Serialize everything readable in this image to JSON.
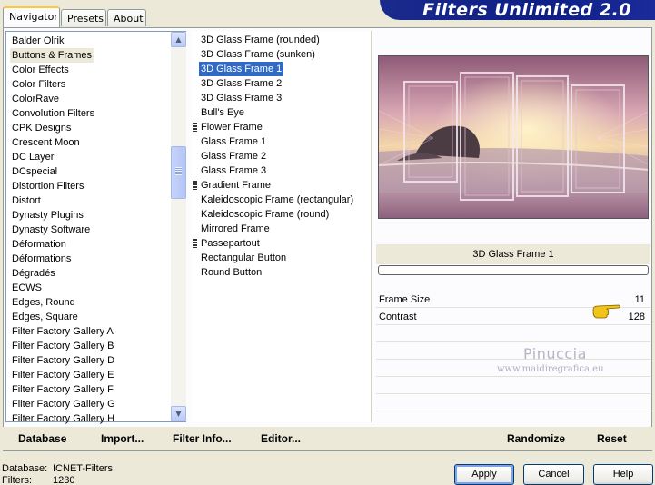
{
  "tabs": [
    "Navigator",
    "Presets",
    "About"
  ],
  "banner_title": "Filters Unlimited 2.0",
  "categories": [
    "Balder Olrik",
    "Buttons & Frames",
    "Color Effects",
    "Color Filters",
    "ColorRave",
    "Convolution Filters",
    "CPK Designs",
    "Crescent Moon",
    "DC Layer",
    "DCspecial",
    "Distortion Filters",
    "Distort",
    "Dynasty Plugins",
    "Dynasty Software",
    "Déformation",
    "Déformations",
    "Dégradés",
    "ECWS",
    "Edges, Round",
    "Edges, Square",
    "Filter Factory Gallery A",
    "Filter Factory Gallery B",
    "Filter Factory Gallery D",
    "Filter Factory Gallery E",
    "Filter Factory Gallery F",
    "Filter Factory Gallery G",
    "Filter Factory Gallery H"
  ],
  "selected_category": "Buttons & Frames",
  "filters": [
    "3D Glass Frame (rounded)",
    "3D Glass Frame (sunken)",
    "3D Glass Frame 1",
    "3D Glass Frame 2",
    "3D Glass Frame 3",
    "Bull's Eye",
    "Flower Frame",
    "Glass Frame 1",
    "Glass Frame 2",
    "Glass Frame 3",
    "Gradient Frame",
    "Kaleidoscopic Frame (rectangular)",
    "Kaleidoscopic Frame (round)",
    "Mirrored Frame",
    "Passepartout",
    "Rectangular Button",
    "Round Button"
  ],
  "selected_filter": "3D Glass Frame 1",
  "marked_filters": [
    "Flower Frame",
    "Gradient Frame",
    "Passepartout"
  ],
  "filter_name_display": "3D Glass Frame 1",
  "params": [
    {
      "label": "Frame Size",
      "value": "11"
    },
    {
      "label": "Contrast",
      "value": "128"
    }
  ],
  "watermark": {
    "name": "Pinuccia",
    "url": "www.maidiregrafica.eu"
  },
  "toolbar": {
    "database": "Database",
    "import": "Import...",
    "filter_info": "Filter Info...",
    "editor": "Editor...",
    "randomize": "Randomize",
    "reset": "Reset"
  },
  "status": {
    "database_label": "Database:",
    "database_value": "ICNET-Filters",
    "filters_label": "Filters:",
    "filters_value": "1230"
  },
  "buttons": {
    "apply": "Apply",
    "cancel": "Cancel",
    "help": "Help"
  }
}
